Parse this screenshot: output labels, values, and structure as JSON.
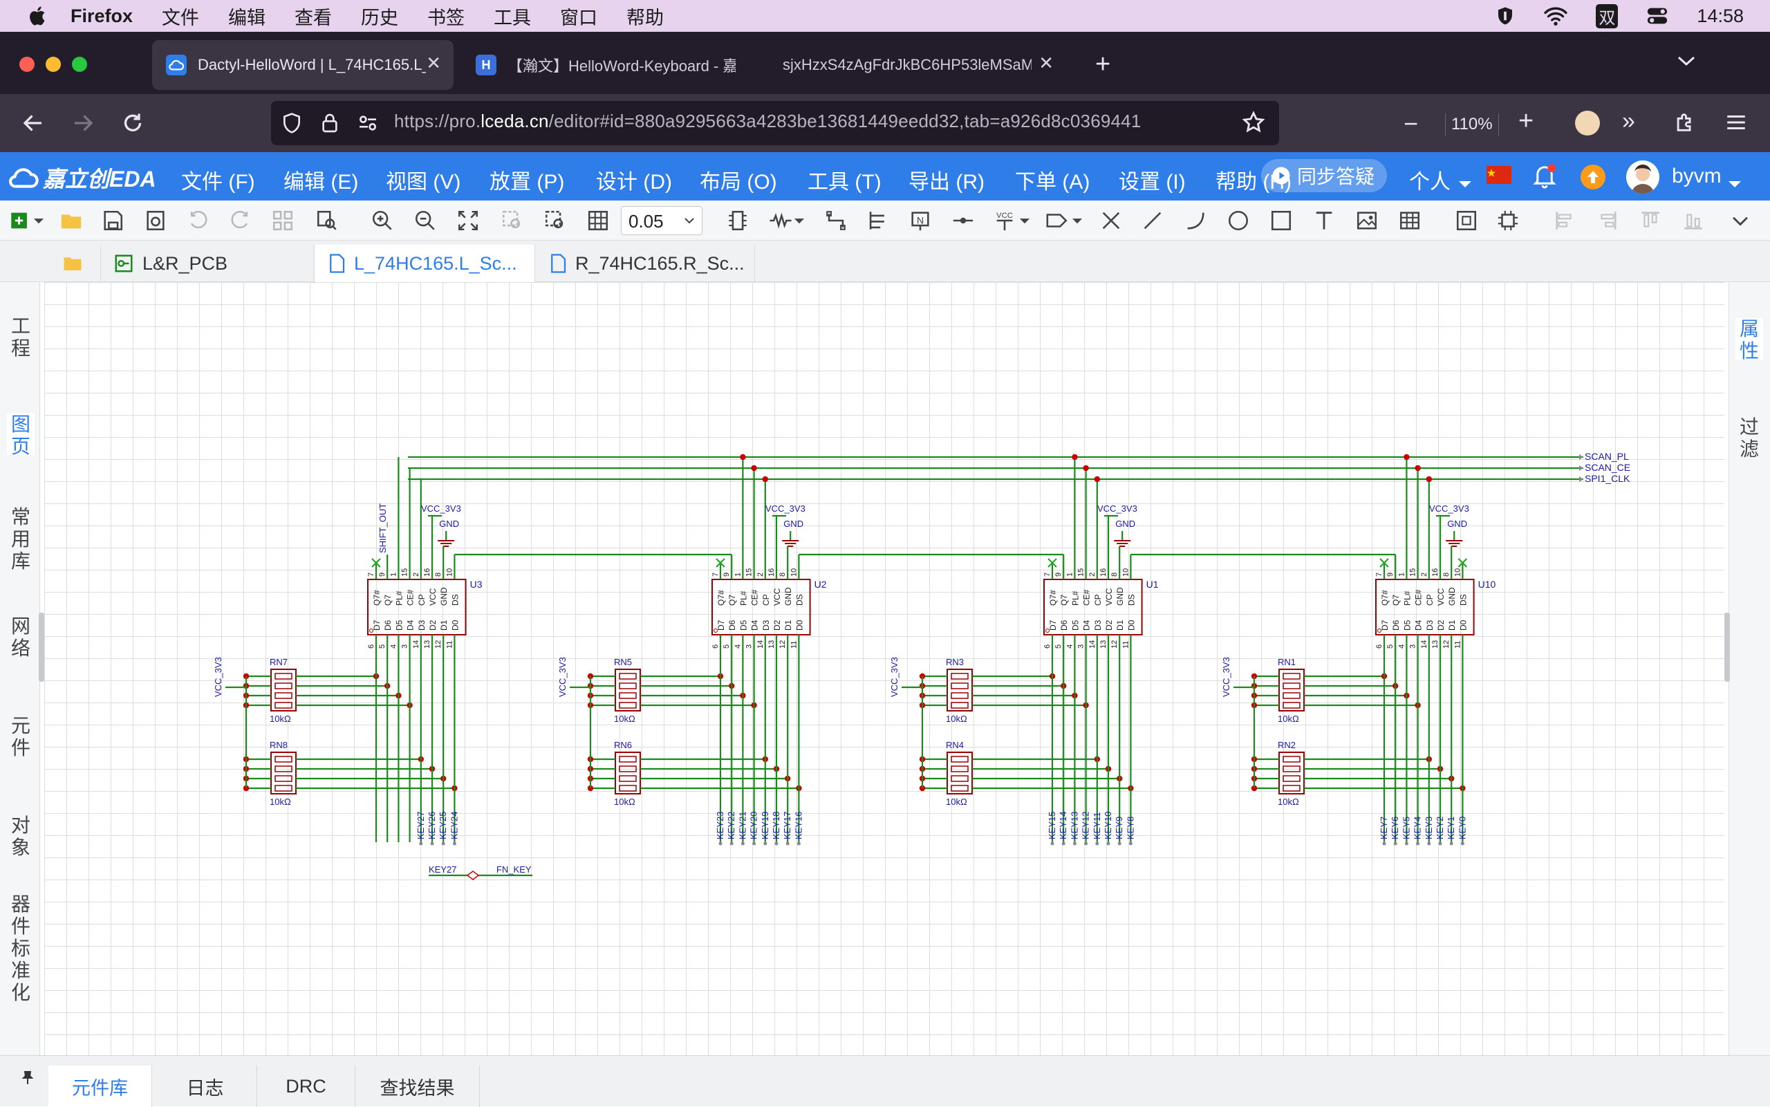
{
  "macos_menu": {
    "app": "Firefox",
    "items": [
      "文件",
      "编辑",
      "查看",
      "历史",
      "书签",
      "工具",
      "窗口",
      "帮助"
    ],
    "input_method": "双",
    "clock": "14:58"
  },
  "browser": {
    "tabs": [
      {
        "title": "Dactyl-HelloWord | L_74HC165.L_Sch",
        "active": true
      },
      {
        "title": "【瀚文】HelloWord-Keyboard - 嘉立创",
        "active": false
      },
      {
        "title": "sjxHzxS4zAgFdrJkBC6HP53leMSaM",
        "active": false
      }
    ],
    "url_prefix": "https://pro.",
    "url_domain": "lceda.cn",
    "url_rest": "/editor#id=880a9295663a4283be13681449eedd32,tab=a926d8c0369441",
    "zoom": "110%"
  },
  "eda": {
    "logo": "嘉立创EDA",
    "menu": [
      "文件 (F)",
      "编辑 (E)",
      "视图 (V)",
      "放置 (P)",
      "设计 (D)",
      "布局 (O)",
      "工具 (T)",
      "导出 (R)",
      "下单 (A)",
      "设置 (I)",
      "帮助 (H)"
    ],
    "overlap_text": "同步答疑",
    "personal": "个人",
    "user": "byvm",
    "grid_value": "0.05",
    "doc_tabs": [
      "L&R_PCB",
      "L_74HC165.L_Sc...",
      "R_74HC165.R_Sc..."
    ],
    "left_panel": [
      "工程",
      "图页",
      "常用库",
      "网络",
      "元件",
      "对象",
      "器件标准化"
    ],
    "right_panel": [
      "属性",
      "过滤"
    ],
    "bottom_tabs": [
      "元件库",
      "日志",
      "DRC",
      "查找结果"
    ]
  },
  "schematic": {
    "nets": [
      "SCAN_PL",
      "SCAN_CE",
      "SPI1_CLK"
    ],
    "chips": [
      {
        "ref": "U3",
        "vcc": "VCC_3V3",
        "gnd": "GND",
        "shift_out": "SHIFT_OUT"
      },
      {
        "ref": "U2",
        "vcc": "VCC_3V3",
        "gnd": "GND"
      },
      {
        "ref": "U1",
        "vcc": "VCC_3V3",
        "gnd": "GND"
      },
      {
        "ref": "U10",
        "vcc": "VCC_3V3",
        "gnd": "GND"
      }
    ],
    "top_pins": [
      "Q7#",
      "Q7",
      "PL#",
      "CE#",
      "CP",
      "VCC",
      "GND",
      "DS"
    ],
    "top_pin_nums": [
      "7",
      "9",
      "1",
      "15",
      "2",
      "16",
      "8",
      "10"
    ],
    "bottom_pins": [
      "D7",
      "D6",
      "D5",
      "D4",
      "D3",
      "D2",
      "D1",
      "D0"
    ],
    "bottom_pin_nums": [
      "6",
      "5",
      "4",
      "3",
      "14",
      "13",
      "12",
      "11"
    ],
    "resistor_networks": [
      {
        "upper": "RN7",
        "lower": "RN8",
        "value": "10kΩ"
      },
      {
        "upper": "RN5",
        "lower": "RN6",
        "value": "10kΩ"
      },
      {
        "upper": "RN3",
        "lower": "RN4",
        "value": "10kΩ"
      },
      {
        "upper": "RN1",
        "lower": "RN2",
        "value": "10kΩ"
      }
    ],
    "resistor_power": "VCC_3V3",
    "key_groups": [
      [
        "KEY27",
        "KEY26",
        "KEY25",
        "KEY24"
      ],
      [
        "KEY23",
        "KEY22",
        "KEY21",
        "KEY20",
        "KEY19",
        "KEY18",
        "KEY17",
        "KEY16"
      ],
      [
        "KEY15",
        "KEY14",
        "KEY13",
        "KEY12",
        "KEY11",
        "KEY10",
        "KEY9",
        "KEY8"
      ],
      [
        "KEY7",
        "KEY6",
        "KEY5",
        "KEY4",
        "KEY3",
        "KEY2",
        "KEY1",
        "KEY0"
      ]
    ],
    "fn_link": {
      "from": "KEY27",
      "to": "FN_KEY"
    }
  },
  "colors": {
    "eda_blue": "#2f7de9",
    "wire": "#1a8a1a",
    "junction": "#cc0000",
    "pin_text": "#1a1aa6",
    "component_outline": "#990000"
  }
}
